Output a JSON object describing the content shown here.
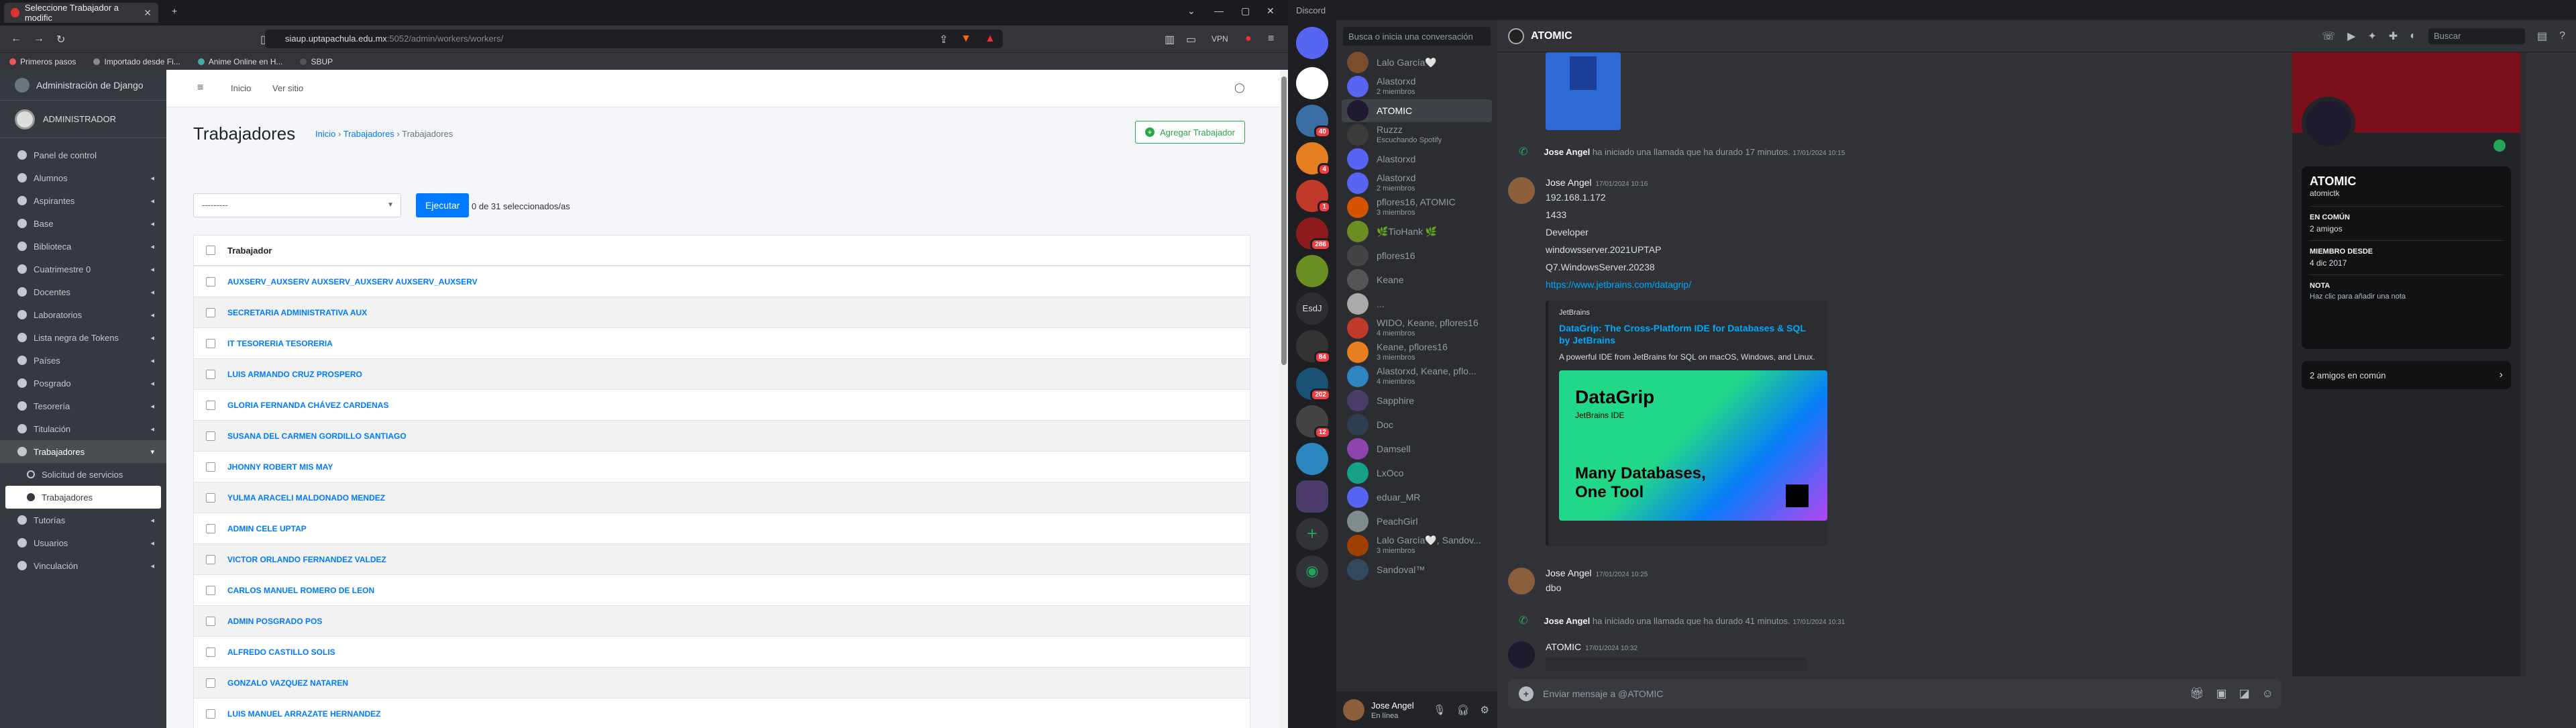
{
  "browser": {
    "tab_title": "Seleccione Trabajador a modific",
    "url_host": "siaup.uptapachula.edu.mx",
    "url_path": ":5052/admin/workers/workers/",
    "vpn_label": "VPN",
    "bookmarks": [
      "Primeros pasos",
      "Importado desde Fi...",
      "Anime Online en H...",
      "SBUP"
    ]
  },
  "django": {
    "brand": "Administración de Django",
    "user": "ADMINISTRADOR",
    "topnav": [
      "Inicio",
      "Ver sitio"
    ],
    "nav": [
      {
        "label": "Panel de control",
        "caret": false
      },
      {
        "label": "Alumnos",
        "caret": true
      },
      {
        "label": "Aspirantes",
        "caret": true
      },
      {
        "label": "Base",
        "caret": true
      },
      {
        "label": "Biblioteca",
        "caret": true
      },
      {
        "label": "Cuatrimestre 0",
        "caret": true
      },
      {
        "label": "Docentes",
        "caret": true
      },
      {
        "label": "Laboratorios",
        "caret": true
      },
      {
        "label": "Lista negra de Tokens",
        "caret": true
      },
      {
        "label": "Países",
        "caret": true
      },
      {
        "label": "Posgrado",
        "caret": true
      },
      {
        "label": "Tesorería",
        "caret": true
      },
      {
        "label": "Titulación",
        "caret": true
      },
      {
        "label": "Trabajadores",
        "caret": true
      }
    ],
    "subnav": [
      "Solicitud de servicios",
      "Trabajadores"
    ],
    "nav_after": [
      "Tutorías",
      "Usuarios",
      "Vinculación"
    ],
    "page_title": "Trabajadores",
    "breadcrumb": [
      "Inicio",
      "Trabajadores",
      "Trabajadores"
    ],
    "add_button": "Agregar Trabajador",
    "action_placeholder": "---------",
    "go_button": "Ejecutar",
    "selected_text": "0 de 31 seleccionados/as",
    "column_header": "Trabajador",
    "rows": [
      "AUXSERV_AUXSERV AUXSERV_AUXSERV AUXSERV_AUXSERV",
      "SECRETARIA ADMINISTRATIVA AUX",
      "IT TESORERIA TESORERIA",
      "LUIS ARMANDO CRUZ PROSPERO",
      "GLORIA FERNANDA CHÁVEZ CARDENAS",
      "SUSANA DEL CARMEN GORDILLO SANTIAGO",
      "JHONNY ROBERT MIS MAY",
      "YULMA ARACELI MALDONADO MENDEZ",
      "ADMIN CELE UPTAP",
      "VICTOR ORLANDO FERNANDEZ VALDEZ",
      "CARLOS MANUEL ROMERO DE LEON",
      "ADMIN POSGRADO POS",
      "ALFREDO CASTILLO SOLIS",
      "GONZALO VAZQUEZ NATAREN",
      "LUIS MANUEL ARRAZATE HERNANDEZ"
    ]
  },
  "discord": {
    "app_title": "Discord",
    "search_placeholder": "Busca o inicia una conversación",
    "server_badges": [
      "40",
      "4",
      "1",
      "286",
      "84",
      "202",
      "12"
    ],
    "server_label": "EsdJ",
    "dms": [
      {
        "name": "Lalo García🤍",
        "status": ""
      },
      {
        "name": "Alastorxd",
        "status": "2 miembros"
      },
      {
        "name": "ATOMIC",
        "status": ""
      },
      {
        "name": "Ruzzz",
        "status": "Escuchando Spotify"
      },
      {
        "name": "Alastorxd",
        "status": ""
      },
      {
        "name": "Alastorxd",
        "status": "2 miembros"
      },
      {
        "name": "pflores16, ATOMIC",
        "status": "3 miembros"
      },
      {
        "name": "🌿TioHank 🌿",
        "status": ""
      },
      {
        "name": "pflores16",
        "status": ""
      },
      {
        "name": "Keane",
        "status": ""
      },
      {
        "name": "...",
        "status": ""
      },
      {
        "name": "WIDO, Keane, pflores16",
        "status": "4 miembros"
      },
      {
        "name": "Keane, pflores16",
        "status": "3 miembros"
      },
      {
        "name": "Alastorxd, Keane, pflo...",
        "status": "4 miembros"
      },
      {
        "name": "Sapphire",
        "status": ""
      },
      {
        "name": "Doc",
        "status": ""
      },
      {
        "name": "Damsell",
        "status": ""
      },
      {
        "name": "LxOco",
        "status": ""
      },
      {
        "name": "eduar_MR",
        "status": ""
      },
      {
        "name": "PeachGirl",
        "status": ""
      },
      {
        "name": "Lalo García🤍, Sandov...",
        "status": "3 miembros"
      },
      {
        "name": "Sandoval™",
        "status": ""
      }
    ],
    "me": {
      "name": "Jose Angel",
      "status": "En línea"
    },
    "chat_title": "ATOMIC",
    "header_search": "Buscar",
    "call1": {
      "who": "Jose Angel",
      "text": "ha iniciado una llamada que ha durado 17 minutos.",
      "time": "17/01/2024 10:15"
    },
    "msg1": {
      "author": "Jose Angel",
      "time": "17/01/2024 10:16",
      "lines": [
        "192.168.1.172",
        "1433",
        "Developer",
        "windowsserver.2021UPTAP",
        "Q7.WindowsServer.20238"
      ],
      "link": "https://www.jetbrains.com/datagrip/"
    },
    "embed": {
      "provider": "JetBrains",
      "title": "DataGrip: The Cross-Platform IDE for Databases & SQL by JetBrains",
      "desc": "A powerful IDE from JetBrains for SQL on macOS, Windows, and Linux.",
      "img_title": "DataGrip",
      "img_sub": "JetBrains IDE",
      "img_tag1": "Many Databases,",
      "img_tag2": "One Tool"
    },
    "msg2": {
      "author": "Jose Angel",
      "time": "17/01/2024 10:25",
      "text": "dbo"
    },
    "call2": {
      "who": "Jose Angel",
      "text": "ha iniciado una llamada que ha durado 41 minutos.",
      "time": "17/01/2024 10:31"
    },
    "msg3": {
      "author": "ATOMIC",
      "time": "17/01/2024 10:32"
    },
    "input_placeholder": "Enviar mensaje a @ATOMIC",
    "profile": {
      "name": "ATOMIC",
      "username": "atomictk",
      "common_label": "EN COMÚN",
      "common_value": "2 amigos",
      "member_label": "MIEMBRO DESDE",
      "member_value": "4 dic 2017",
      "note_label": "NOTA",
      "note_placeholder": "Haz clic para añadir una nota",
      "mutual": "2 amigos en común"
    }
  }
}
